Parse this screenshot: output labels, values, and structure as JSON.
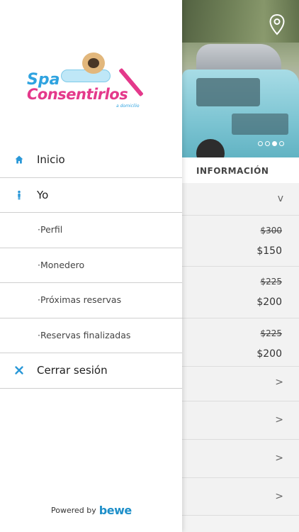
{
  "drawer": {
    "logo": {
      "line1": "Spa",
      "line2": "Consentirlos",
      "line3": "a domicilio"
    },
    "menu": [
      {
        "label": "Inicio",
        "icon": "home-icon"
      },
      {
        "label": "Yo",
        "icon": "person-icon"
      },
      {
        "label": "·Perfil"
      },
      {
        "label": "·Monedero"
      },
      {
        "label": "·Próximas reservas"
      },
      {
        "label": "·Reservas finalizadas"
      },
      {
        "label": "Cerrar sesión",
        "icon": "close-icon"
      }
    ],
    "footer": {
      "powered_label": "Powered by",
      "brand": "bewe"
    }
  },
  "background": {
    "section_title": "INFORMACIÓN",
    "collapsed_chevron": "v",
    "prices": [
      {
        "old": "$300",
        "new": "$150"
      },
      {
        "old": "$225",
        "new": "$200"
      },
      {
        "old": "$225",
        "new": "$200"
      }
    ],
    "arrow_rows": [
      ">",
      ">",
      ">",
      ">"
    ],
    "carousel": {
      "slides": 4,
      "active": 3
    }
  },
  "colors": {
    "accent": "#2a98d8",
    "brand_pink": "#e4398b",
    "brand_blue": "#2fa3e0"
  }
}
